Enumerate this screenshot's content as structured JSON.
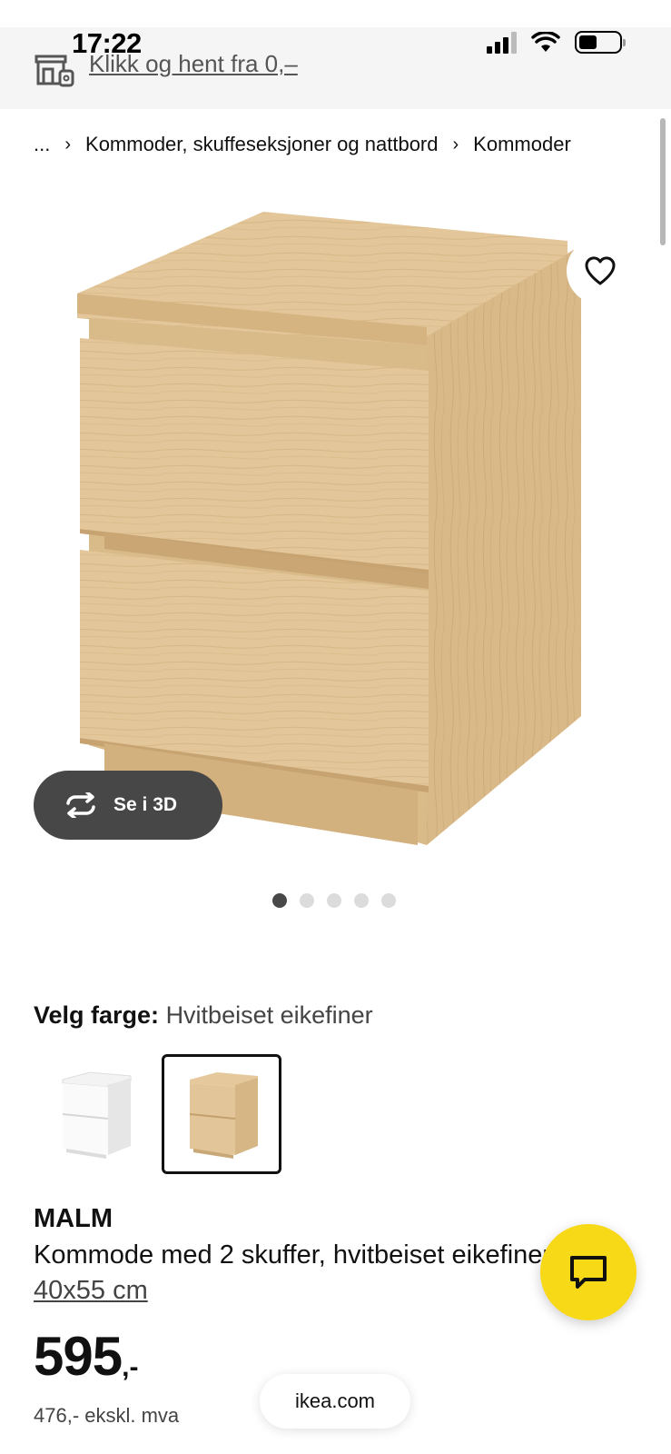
{
  "status_bar": {
    "time": "17:22"
  },
  "promo": {
    "pickup_text": "Klikk og hent fra 0,–",
    "icon": "store-icon"
  },
  "breadcrumb": {
    "items": [
      "...",
      "Kommoder, skuffeseksjoner og nattbord",
      "Kommoder"
    ]
  },
  "gallery": {
    "view_3d_label": "Se i 3D",
    "dot_count": 5,
    "active_dot": 1
  },
  "color_picker": {
    "label": "Velg farge:",
    "selected_value": "Hvitbeiset eikefiner",
    "options": [
      "white",
      "white-stained-oak"
    ],
    "selected_index": 1
  },
  "product": {
    "name": "MALM",
    "description": "Kommode med 2 skuffer, hvitbeiset eikefiner,",
    "size": "40x55 cm",
    "price_number": "595",
    "price_suffix": ",-",
    "price_ex_vat": "476,- ekskl. mva"
  },
  "browser": {
    "url": "ikea.com"
  },
  "colors": {
    "chat_button": "#f7d917",
    "view3d_button": "#474747",
    "wood": "#e2c598"
  }
}
